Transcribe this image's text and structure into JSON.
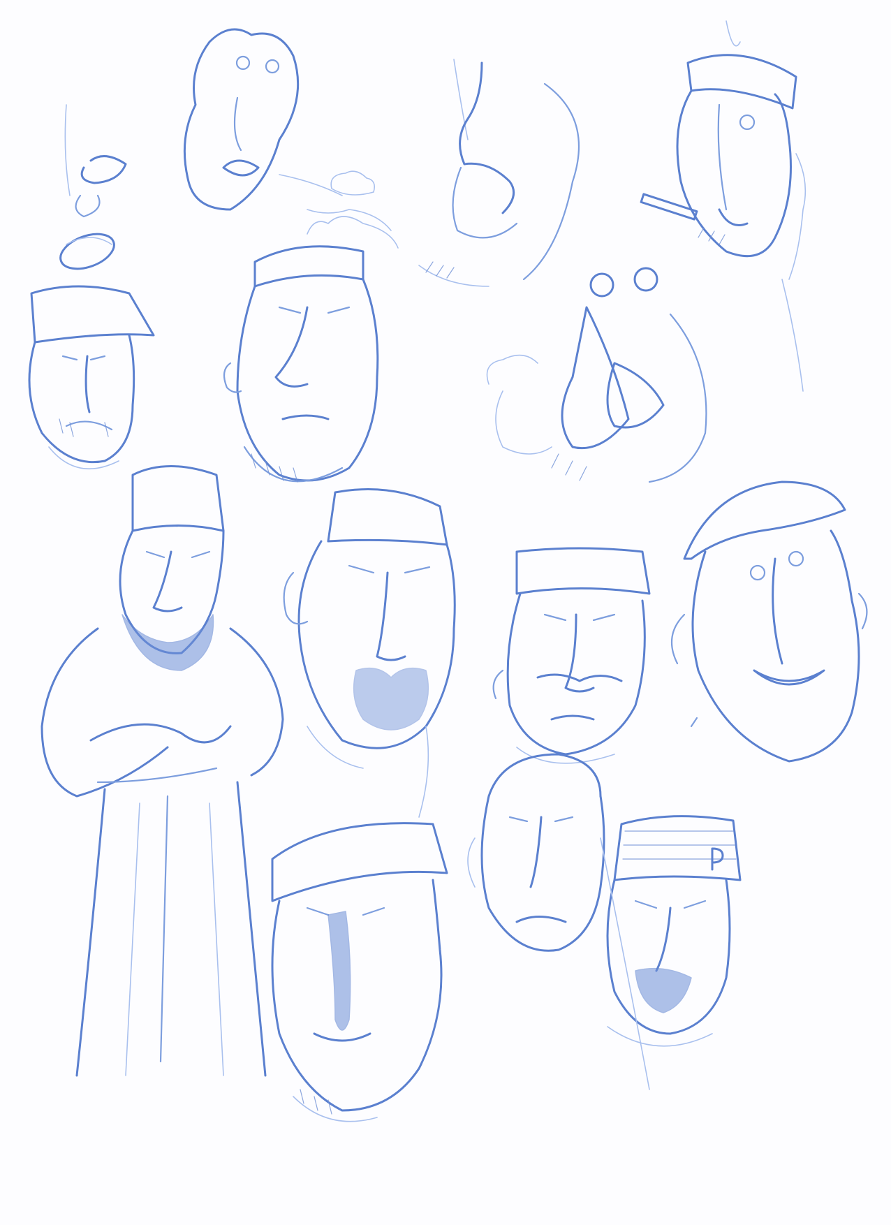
{
  "sheet": {
    "paper_color": "#fdfdff",
    "pencil_color": "#5b80cf",
    "light_pencil_color": "#a9c0ee"
  }
}
